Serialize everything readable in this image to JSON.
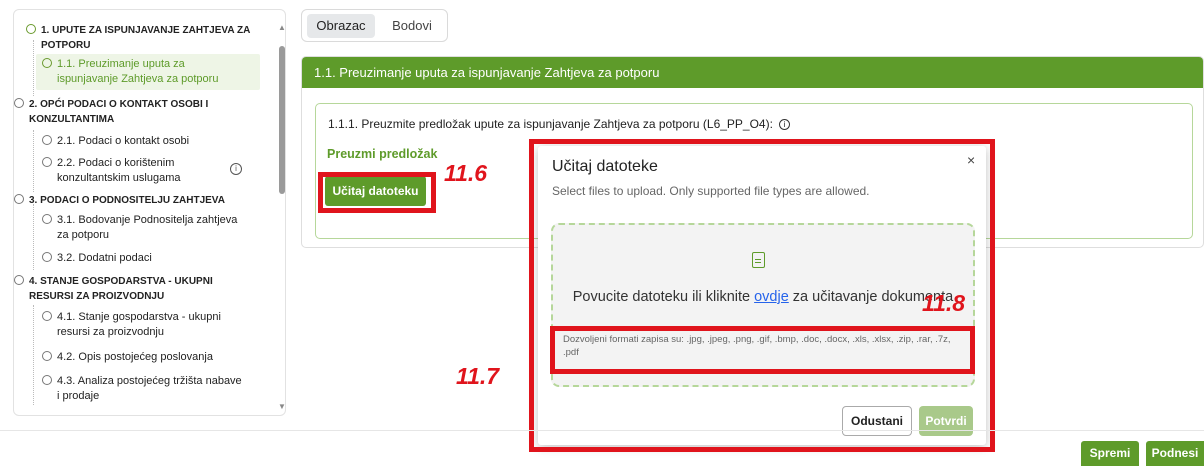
{
  "sidebar": {
    "items": [
      {
        "lines": [
          "1. UPUTE ZA ISPUNJAVANJE ZAHTJEVA ZA",
          "POTPORU"
        ]
      },
      {
        "lines": [
          "1.1. Preuzimanje uputa za",
          "ispunjavanje Zahtjeva za potporu"
        ]
      },
      {
        "lines": [
          "2. OPĆI PODACI O KONTAKT OSOBI I",
          "KONZULTANTIMA"
        ]
      },
      {
        "lines": [
          "2.1. Podaci o kontakt osobi"
        ]
      },
      {
        "lines": [
          "2.2. Podaci o korištenim",
          "konzultantskim uslugama"
        ]
      },
      {
        "lines": [
          "3. PODACI O PODNOSITELJU ZAHTJEVA"
        ]
      },
      {
        "lines": [
          "3.1. Bodovanje Podnositelja zahtjeva",
          "za potporu"
        ]
      },
      {
        "lines": [
          "3.2. Dodatni podaci"
        ]
      },
      {
        "lines": [
          "4. STANJE GOSPODARSTVA - UKUPNI",
          "RESURSI ZA PROIZVODNJU"
        ]
      },
      {
        "lines": [
          "4.1. Stanje gospodarstva - ukupni",
          "resursi za proizvodnju"
        ]
      },
      {
        "lines": [
          "4.2. Opis postojećeg poslovanja"
        ]
      },
      {
        "lines": [
          "4.3. Analiza postojećeg tržišta nabave",
          "i prodaje"
        ]
      }
    ]
  },
  "tabs": [
    "Obrazac",
    "Bodovi"
  ],
  "panel": {
    "title": "1.1. Preuzimanje uputa za ispunjavanje Zahtjeva za potporu",
    "field_label": "1.1.1. Preuzmite predložak upute za ispunjavanje Zahtjeva za potporu (L6_PP_O4):",
    "info_glyph": "i",
    "download_link": "Preuzmi predložak",
    "upload_button": "Učitaj datoteku"
  },
  "modal": {
    "title": "Učitaj datoteke",
    "subtitle": "Select files to upload. Only supported file types are allowed.",
    "close": "×",
    "drop_text_before": "Povucite datoteku ili kliknite ",
    "drop_link": "ovdje",
    "drop_text_after": " za učitavanje dokumenta",
    "formats": "Dozvoljeni formati zapisa su: .jpg, .jpeg, .png, .gif, .bmp, .doc, .docx, .xls, .xlsx, .zip, .rar, .7z, .pdf",
    "cancel": "Odustani",
    "confirm": "Potvrdi"
  },
  "annotations": {
    "a1": "11.6",
    "a2": "11.7",
    "a3": "11.8"
  },
  "footer": {
    "save": "Spremi",
    "submit": "Podnesi"
  },
  "colors": {
    "accent": "#5e9b2a",
    "highlight": "#e0141c"
  }
}
